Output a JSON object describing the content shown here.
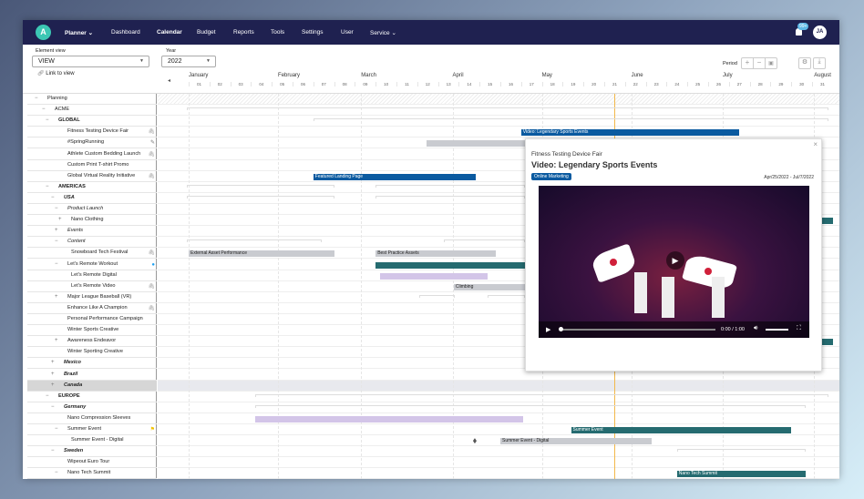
{
  "nav": {
    "logo": "A",
    "items": [
      {
        "label": "Planner ⌄",
        "bold": true
      },
      {
        "label": "Dashboard"
      },
      {
        "label": "Calendar",
        "bold": true
      },
      {
        "label": "Budget"
      },
      {
        "label": "Reports"
      },
      {
        "label": "Tools"
      },
      {
        "label": "Settings"
      },
      {
        "label": "User"
      },
      {
        "label": "Service ⌄"
      }
    ],
    "notifications": "99+",
    "avatar": "JA"
  },
  "element_view": {
    "label": "Element view",
    "value": "VIEW",
    "link": "Link to view"
  },
  "year": {
    "label": "Year",
    "value": "2022"
  },
  "period": {
    "label": "Period",
    "zoom_in": "+",
    "zoom_out": "−"
  },
  "timeline": {
    "months": [
      {
        "name": "January",
        "week": 1
      },
      {
        "name": "February",
        "week": 5.3
      },
      {
        "name": "March",
        "week": 9.3
      },
      {
        "name": "April",
        "week": 13.7
      },
      {
        "name": "May",
        "week": 18
      },
      {
        "name": "June",
        "week": 22.3
      },
      {
        "name": "July",
        "week": 26.7
      },
      {
        "name": "August",
        "week": 31.1
      }
    ],
    "weeks": [
      "01",
      "02",
      "03",
      "04",
      "05",
      "06",
      "07",
      "08",
      "09",
      "10",
      "11",
      "12",
      "13",
      "14",
      "15",
      "16",
      "17",
      "18",
      "19",
      "20",
      "21",
      "22",
      "23",
      "24",
      "25",
      "26",
      "27",
      "28",
      "29",
      "30",
      "31"
    ],
    "today_week": 21.5
  },
  "tree": [
    {
      "label": "Planning",
      "level": 0,
      "toggle": "−"
    },
    {
      "label": "ACME",
      "level": 1,
      "toggle": "−"
    },
    {
      "label": "GLOBAL",
      "level": 2,
      "toggle": "−",
      "style": "b"
    },
    {
      "label": "Fitness Testing Device Fair",
      "level": 4,
      "icon": "paperclip"
    },
    {
      "label": "#SpringRunning",
      "level": 4,
      "icon": "note"
    },
    {
      "label": "Athlete Custom Bedding Launch",
      "level": 4,
      "icon": "paperclip"
    },
    {
      "label": "Custom Print T-shirt Promo",
      "level": 4
    },
    {
      "label": "Global Virtual Reality Initiative",
      "level": 4,
      "icon": "paperclip"
    },
    {
      "label": "AMERICAS",
      "level": 2,
      "toggle": "−",
      "style": "b"
    },
    {
      "label": "USA",
      "level": 3,
      "toggle": "−",
      "style": "bi"
    },
    {
      "label": "Product Launch",
      "level": 4,
      "toggle": "−",
      "style": "i"
    },
    {
      "label": "Nano Clothing",
      "level": 5,
      "toggle": "+"
    },
    {
      "label": "Events",
      "level": 4,
      "toggle": "+",
      "style": "i"
    },
    {
      "label": "Content",
      "level": 4,
      "toggle": "−",
      "style": "i"
    },
    {
      "label": "Snowboard Tech Festival",
      "level": 5,
      "icon": "paperclip"
    },
    {
      "label": "Let's Remote Workout",
      "level": 4,
      "toggle": "−",
      "icon": "twitter"
    },
    {
      "label": "Let's Remote Digital",
      "level": 5
    },
    {
      "label": "Let's Remote Video",
      "level": 5,
      "icon": "paperclip"
    },
    {
      "label": "Major League Baseball (VR)",
      "level": 4,
      "toggle": "+"
    },
    {
      "label": "Enhance Like A Champion",
      "level": 4,
      "icon": "paperclip"
    },
    {
      "label": "Personal Performance Campaign",
      "level": 4
    },
    {
      "label": "Winter Sports Creative",
      "level": 4
    },
    {
      "label": "Awareness Endeavor",
      "level": 4,
      "toggle": "+"
    },
    {
      "label": "Winter Sporting Creative",
      "level": 4
    },
    {
      "label": "Mexico",
      "level": 3,
      "toggle": "+",
      "style": "bi"
    },
    {
      "label": "Brazil",
      "level": 3,
      "toggle": "+",
      "style": "bi"
    },
    {
      "label": "Canada",
      "level": 3,
      "toggle": "+",
      "style": "bi",
      "selected": true
    },
    {
      "label": "EUROPE",
      "level": 2,
      "toggle": "−",
      "style": "b"
    },
    {
      "label": "Germany",
      "level": 3,
      "toggle": "−",
      "style": "bi"
    },
    {
      "label": "Nano Compression Sleeves",
      "level": 4
    },
    {
      "label": "Summer Event",
      "level": 4,
      "toggle": "−",
      "icon": "flag"
    },
    {
      "label": "Summer Event - Digital",
      "level": 5
    },
    {
      "label": "Sweden",
      "level": 3,
      "toggle": "−",
      "style": "bi"
    },
    {
      "label": "Wipeout Euro Tour",
      "level": 4
    },
    {
      "label": "Nano Tech Summit",
      "level": 4,
      "toggle": "−"
    }
  ],
  "brackets": [
    [
      1,
      0.9,
      31.8
    ],
    [
      2,
      7,
      31.8
    ],
    [
      8,
      0.9,
      8
    ],
    [
      8,
      10,
      17.2
    ],
    [
      9,
      0.9,
      8
    ],
    [
      9,
      10,
      17.2
    ],
    [
      13,
      0.9,
      7.4
    ],
    [
      13,
      13.3,
      17.2
    ],
    [
      14,
      1,
      8
    ],
    [
      14,
      10,
      15.8
    ],
    [
      18,
      12.1,
      13.8
    ],
    [
      18,
      15.4,
      17.2
    ],
    [
      27,
      4.2,
      31.8
    ],
    [
      28,
      4.2,
      30.7
    ],
    [
      31,
      16,
      23.3
    ],
    [
      32,
      24.5,
      30.7
    ]
  ],
  "bars": [
    {
      "row": 3,
      "start": 17,
      "end": 27.5,
      "label": "Video: Legendary Sports Events",
      "kind": "blue"
    },
    {
      "row": 4,
      "start": 12.45,
      "end": 20,
      "label": "",
      "kind": "gray"
    },
    {
      "row": 7,
      "start": 7,
      "end": 14.8,
      "label": "Featured Landing Page",
      "kind": "blue"
    },
    {
      "row": 14,
      "start": 1,
      "end": 8,
      "label": "External Asset Performance",
      "kind": "gray"
    },
    {
      "row": 14,
      "start": 10,
      "end": 15.8,
      "label": "Best Practice Assets",
      "kind": "gray"
    },
    {
      "row": 15,
      "start": 10,
      "end": 20,
      "label": "",
      "kind": "teal"
    },
    {
      "row": 11,
      "start": 31.5,
      "end": 32,
      "label": "",
      "kind": "teal"
    },
    {
      "row": 22,
      "start": 31.5,
      "end": 32,
      "label": "",
      "kind": "teal"
    },
    {
      "row": 16,
      "start": 10.2,
      "end": 15.4,
      "label": "",
      "kind": "lavender"
    },
    {
      "row": 17,
      "start": 13.76,
      "end": 18,
      "label": "Climbing",
      "kind": "gray"
    },
    {
      "row": 29,
      "start": 4.2,
      "end": 17.1,
      "label": "",
      "kind": "lavender"
    },
    {
      "row": 30,
      "start": 19.4,
      "end": 30,
      "label": "Summer Event",
      "kind": "teal"
    },
    {
      "row": 31,
      "start": 16,
      "end": 23.3,
      "label": "Summer Event - Digital",
      "kind": "gray"
    },
    {
      "row": 34,
      "start": 24.5,
      "end": 30.7,
      "label": "Nano Tech Summit",
      "kind": "teal"
    }
  ],
  "milestones": [
    {
      "row": 31,
      "week": 14.77
    }
  ],
  "colors": {
    "blue": "#0a5aa0",
    "teal": "#256b70",
    "gray": "#c9cbd0",
    "lavender": "#d3c5e8",
    "today": "#f2b84b",
    "nav": "#1f2150"
  },
  "popup": {
    "parent": "Fitness Testing Device Fair",
    "title": "Video: Legendary Sports Events",
    "tag": "Online Marketing",
    "dates": "Apr/25/2022 - Jul/7/2022",
    "video": {
      "time": "0:00 / 1:00",
      "progress": 0,
      "volume": 1
    }
  }
}
